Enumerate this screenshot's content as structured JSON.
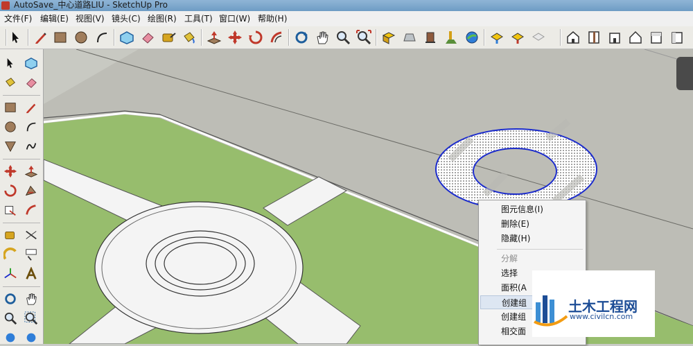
{
  "window": {
    "title": "AutoSave_中心道路LIU - SketchUp Pro"
  },
  "menu": [
    "文件(F)",
    "编辑(E)",
    "视图(V)",
    "镜头(C)",
    "绘图(R)",
    "工具(T)",
    "窗口(W)",
    "帮助(H)"
  ],
  "toolbar_icons": [
    "select-icon",
    "pencil-icon",
    "rectangle-icon",
    "circle-icon",
    "arc-icon",
    "make-component-icon",
    "eraser-icon",
    "tape-measure-icon",
    "paint-bucket-icon",
    "push-pull-icon",
    "move-icon",
    "rotate-icon",
    "offset-icon",
    "orbit-icon",
    "pan-icon",
    "zoom-icon",
    "zoom-extents-icon",
    "get-models-icon",
    "share-model-icon",
    "components-icon",
    "add-location-icon",
    "toggle-terrain-icon",
    "preview-google-earth-icon",
    "photo-textures-icon",
    "iso-view-icon",
    "top-view-icon",
    "front-view-icon",
    "right-view-icon",
    "back-view-icon",
    "left-view-icon"
  ],
  "context_menu": {
    "items": [
      {
        "label": "图元信息(I)",
        "disabled": false
      },
      {
        "label": "删除(E)",
        "disabled": false
      },
      {
        "label": "隐藏(H)",
        "disabled": false
      },
      {
        "label": "分解",
        "disabled": true
      },
      {
        "label": "选择",
        "disabled": false
      },
      {
        "label": "面积(A",
        "disabled": false
      },
      {
        "label": "创建组",
        "disabled": false
      },
      {
        "label": "创建组",
        "disabled": false
      },
      {
        "label": "相交面",
        "disabled": false
      }
    ]
  },
  "watermark": {
    "brand": "土木工程网",
    "url": "www.civilcn.com"
  },
  "colors": {
    "grass": "#97bd6d",
    "road": "#bcbdb6",
    "sky": "#c9cbc6",
    "selection": "#1b2bcc"
  }
}
